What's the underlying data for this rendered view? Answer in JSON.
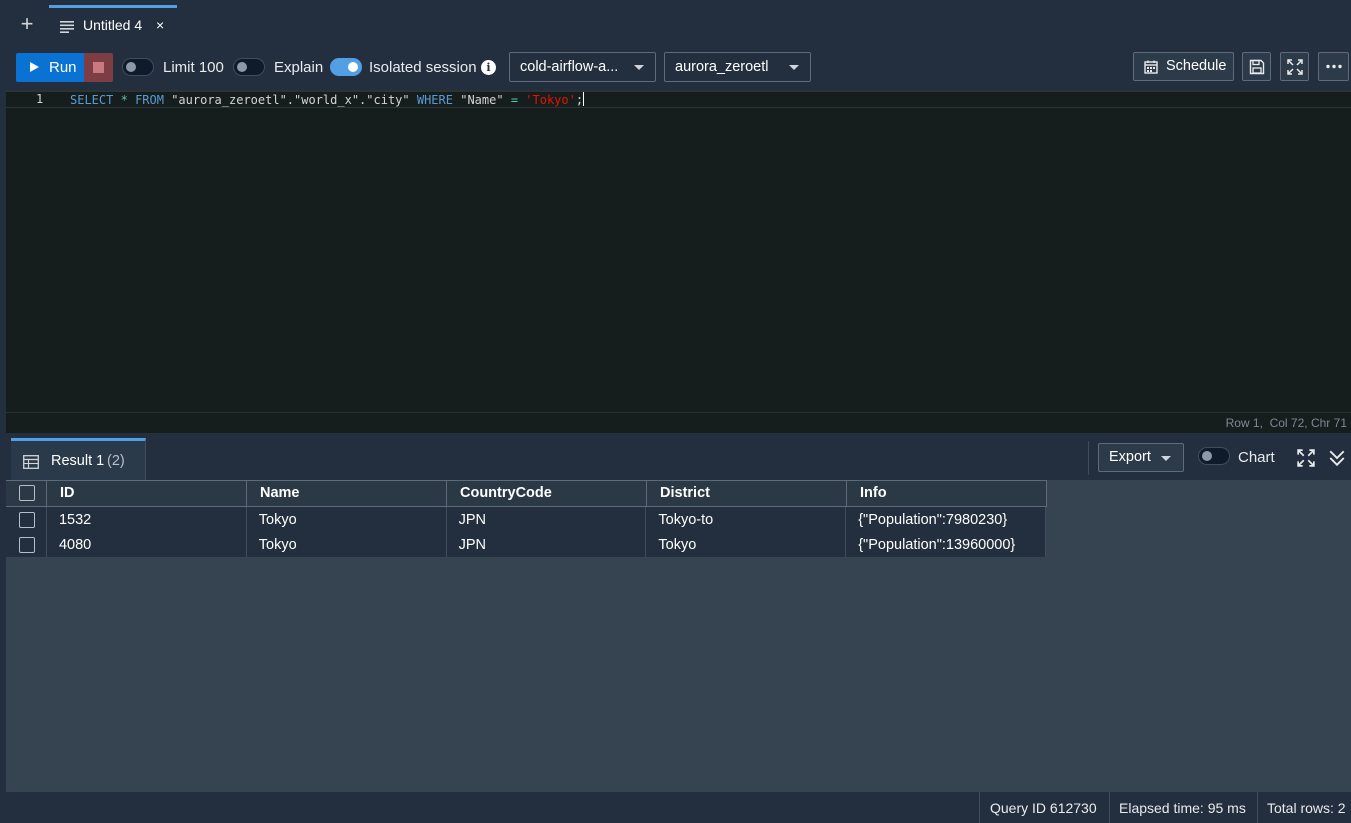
{
  "tabs": [
    {
      "label": "Untitled 4",
      "close": "×"
    }
  ],
  "toolbar": {
    "run_label": "Run",
    "limit_label": "Limit 100",
    "limit_on": false,
    "explain_label": "Explain",
    "explain_on": false,
    "isolated_label": "Isolated session",
    "isolated_on": true,
    "connection": "cold-airflow-a...",
    "database": "aurora_zeroetl",
    "schedule_label": "Schedule"
  },
  "editor": {
    "line_number": "1",
    "query": {
      "kw_select": "SELECT",
      "star": "*",
      "kw_from": "FROM",
      "identifier": "\"aurora_zeroetl\".\"world_x\".\"city\"",
      "kw_where": "WHERE",
      "column": "\"Name\"",
      "eq": "=",
      "literal": "'Tokyo'",
      "semi": ";"
    },
    "status_row": "Row 1,",
    "status_col": "Col 72,",
    "status_chr": "Chr 71"
  },
  "results": {
    "tab_label": "Result 1",
    "tab_count": "(2)",
    "export_label": "Export",
    "chart_label": "Chart",
    "chart_on": false,
    "columns": [
      "ID",
      "Name",
      "CountryCode",
      "District",
      "Info"
    ],
    "rows": [
      [
        "1532",
        "Tokyo",
        "JPN",
        "Tokyo-to",
        "{\"Population\":7980230}"
      ],
      [
        "4080",
        "Tokyo",
        "JPN",
        "Tokyo",
        "{\"Population\":13960000}"
      ]
    ]
  },
  "footer": {
    "query_id": "Query ID 612730",
    "elapsed": "Elapsed time: 95 ms",
    "total_rows": "Total rows: 2"
  },
  "colors": {
    "accent": "#539fe5",
    "run_button": "#0972d3",
    "stop_button": "#7d3e43",
    "string_literal": "#e51400",
    "keyword": "#569cd6"
  }
}
